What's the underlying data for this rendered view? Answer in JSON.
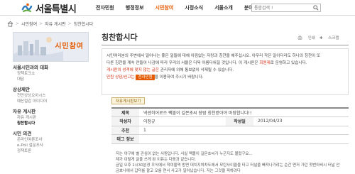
{
  "header": {
    "logo_text": "서울특별시",
    "nav": [
      {
        "label": "전자민원",
        "active": false,
        "caret": false
      },
      {
        "label": "행정정보",
        "active": false,
        "caret": false
      },
      {
        "label": "시민참여",
        "active": true,
        "caret": false
      },
      {
        "label": "시정소식",
        "active": false,
        "caret": false
      },
      {
        "label": "서울소개",
        "active": false,
        "caret": false
      },
      {
        "label": "분야별 정보",
        "active": false,
        "caret": true
      }
    ],
    "caret_glyph": "▼",
    "search_placeholder": "통합검색 !"
  },
  "breadcrumb": {
    "items": [
      "시민참여",
      "자유 게시판",
      "칭찬합시다"
    ],
    "separator": ">"
  },
  "banner": {
    "title": "시민참여"
  },
  "sidebar": {
    "groups": [
      {
        "title": "서울시민과의 대화",
        "items": [
          {
            "label": "정책토크쇼",
            "active": false
          },
          {
            "label": "대담",
            "active": false
          }
        ]
      },
      {
        "title": "상상제안",
        "items": [
          {
            "label": "천만상상오아시스",
            "active": false
          },
          {
            "label": "예산절감 아이디어",
            "active": false
          }
        ]
      },
      {
        "title": "자유 게시판",
        "items": [
          {
            "label": "자유 게시판",
            "active": false
          },
          {
            "label": "칭찬합시다",
            "active": true
          }
        ]
      },
      {
        "title": "시민 의견",
        "items": [
          {
            "label": "온라인여론조사",
            "active": false
          },
          {
            "label": "e-Poll 설문조사",
            "active": false
          },
          {
            "label": "정책토론",
            "active": false
          }
        ]
      }
    ]
  },
  "content": {
    "page_title": "칭찬합시다",
    "tools": {
      "print": "인쇄",
      "scrap": "스크랩"
    },
    "notice": {
      "line1": "시민여러분의 주변에서 일어나는 좋은 일들에 대해 아낌없는 자랑과 칭찬을 해주십시오. 아무리 작은 일이더라도 하나의 칭찬이 또",
      "line2": "다른 칭찬을 계속 만들어 나감에 따라 우리의 서울은 더욱 아름다워질 것입니다. 이 게시판은",
      "highlight_login": "회원제",
      "line2_end": "로 운영하고 있습니다.",
      "line3_red": "게시판의 성격에 맞지 않는 글은",
      "line3": "관리자에 의해 통보없이 삭제될 수 있습니다.",
      "line4_red": "민원 상담/신고는",
      "line4_btn": "전자민원",
      "line4": "을 이용하여 주시기 바랍니다."
    },
    "list_button": "자유게시판보기",
    "detail": {
      "subject_label": "제목",
      "subject_value": "넥센히어로즈 팩볼이 길몬초씨 장람 칭찬받아야 마땅합니다!!",
      "author_label": "작성자",
      "author_value": "이정규",
      "date_label": "작성일",
      "date_value": "2012/04/23",
      "recommend_label": "추천",
      "recommend_value": "1",
      "tag_label": "태그 정보",
      "tag_value": ""
    },
    "body_lines": [
      "저는 야구에 별 관심이 없는 사람입니다. 사실 팩볼이 길몬초씨가 누군지도 몰랐구요...",
      "제가 이렇게 글을 쓰게 된 이유는 다음과 같습니다.",
      "금일 오후 1시30분경 우식에서 학여울역 방면 대치지하차도에서 모탄사이클을 타고 터널을 빠져나가려는 순간 면저 가던 첫번아비시 터널 안 금호나에서 갑미를 팔고 오를 면서 사고가 일어났습니다. 저는 그것을 피하려다"
    ]
  }
}
